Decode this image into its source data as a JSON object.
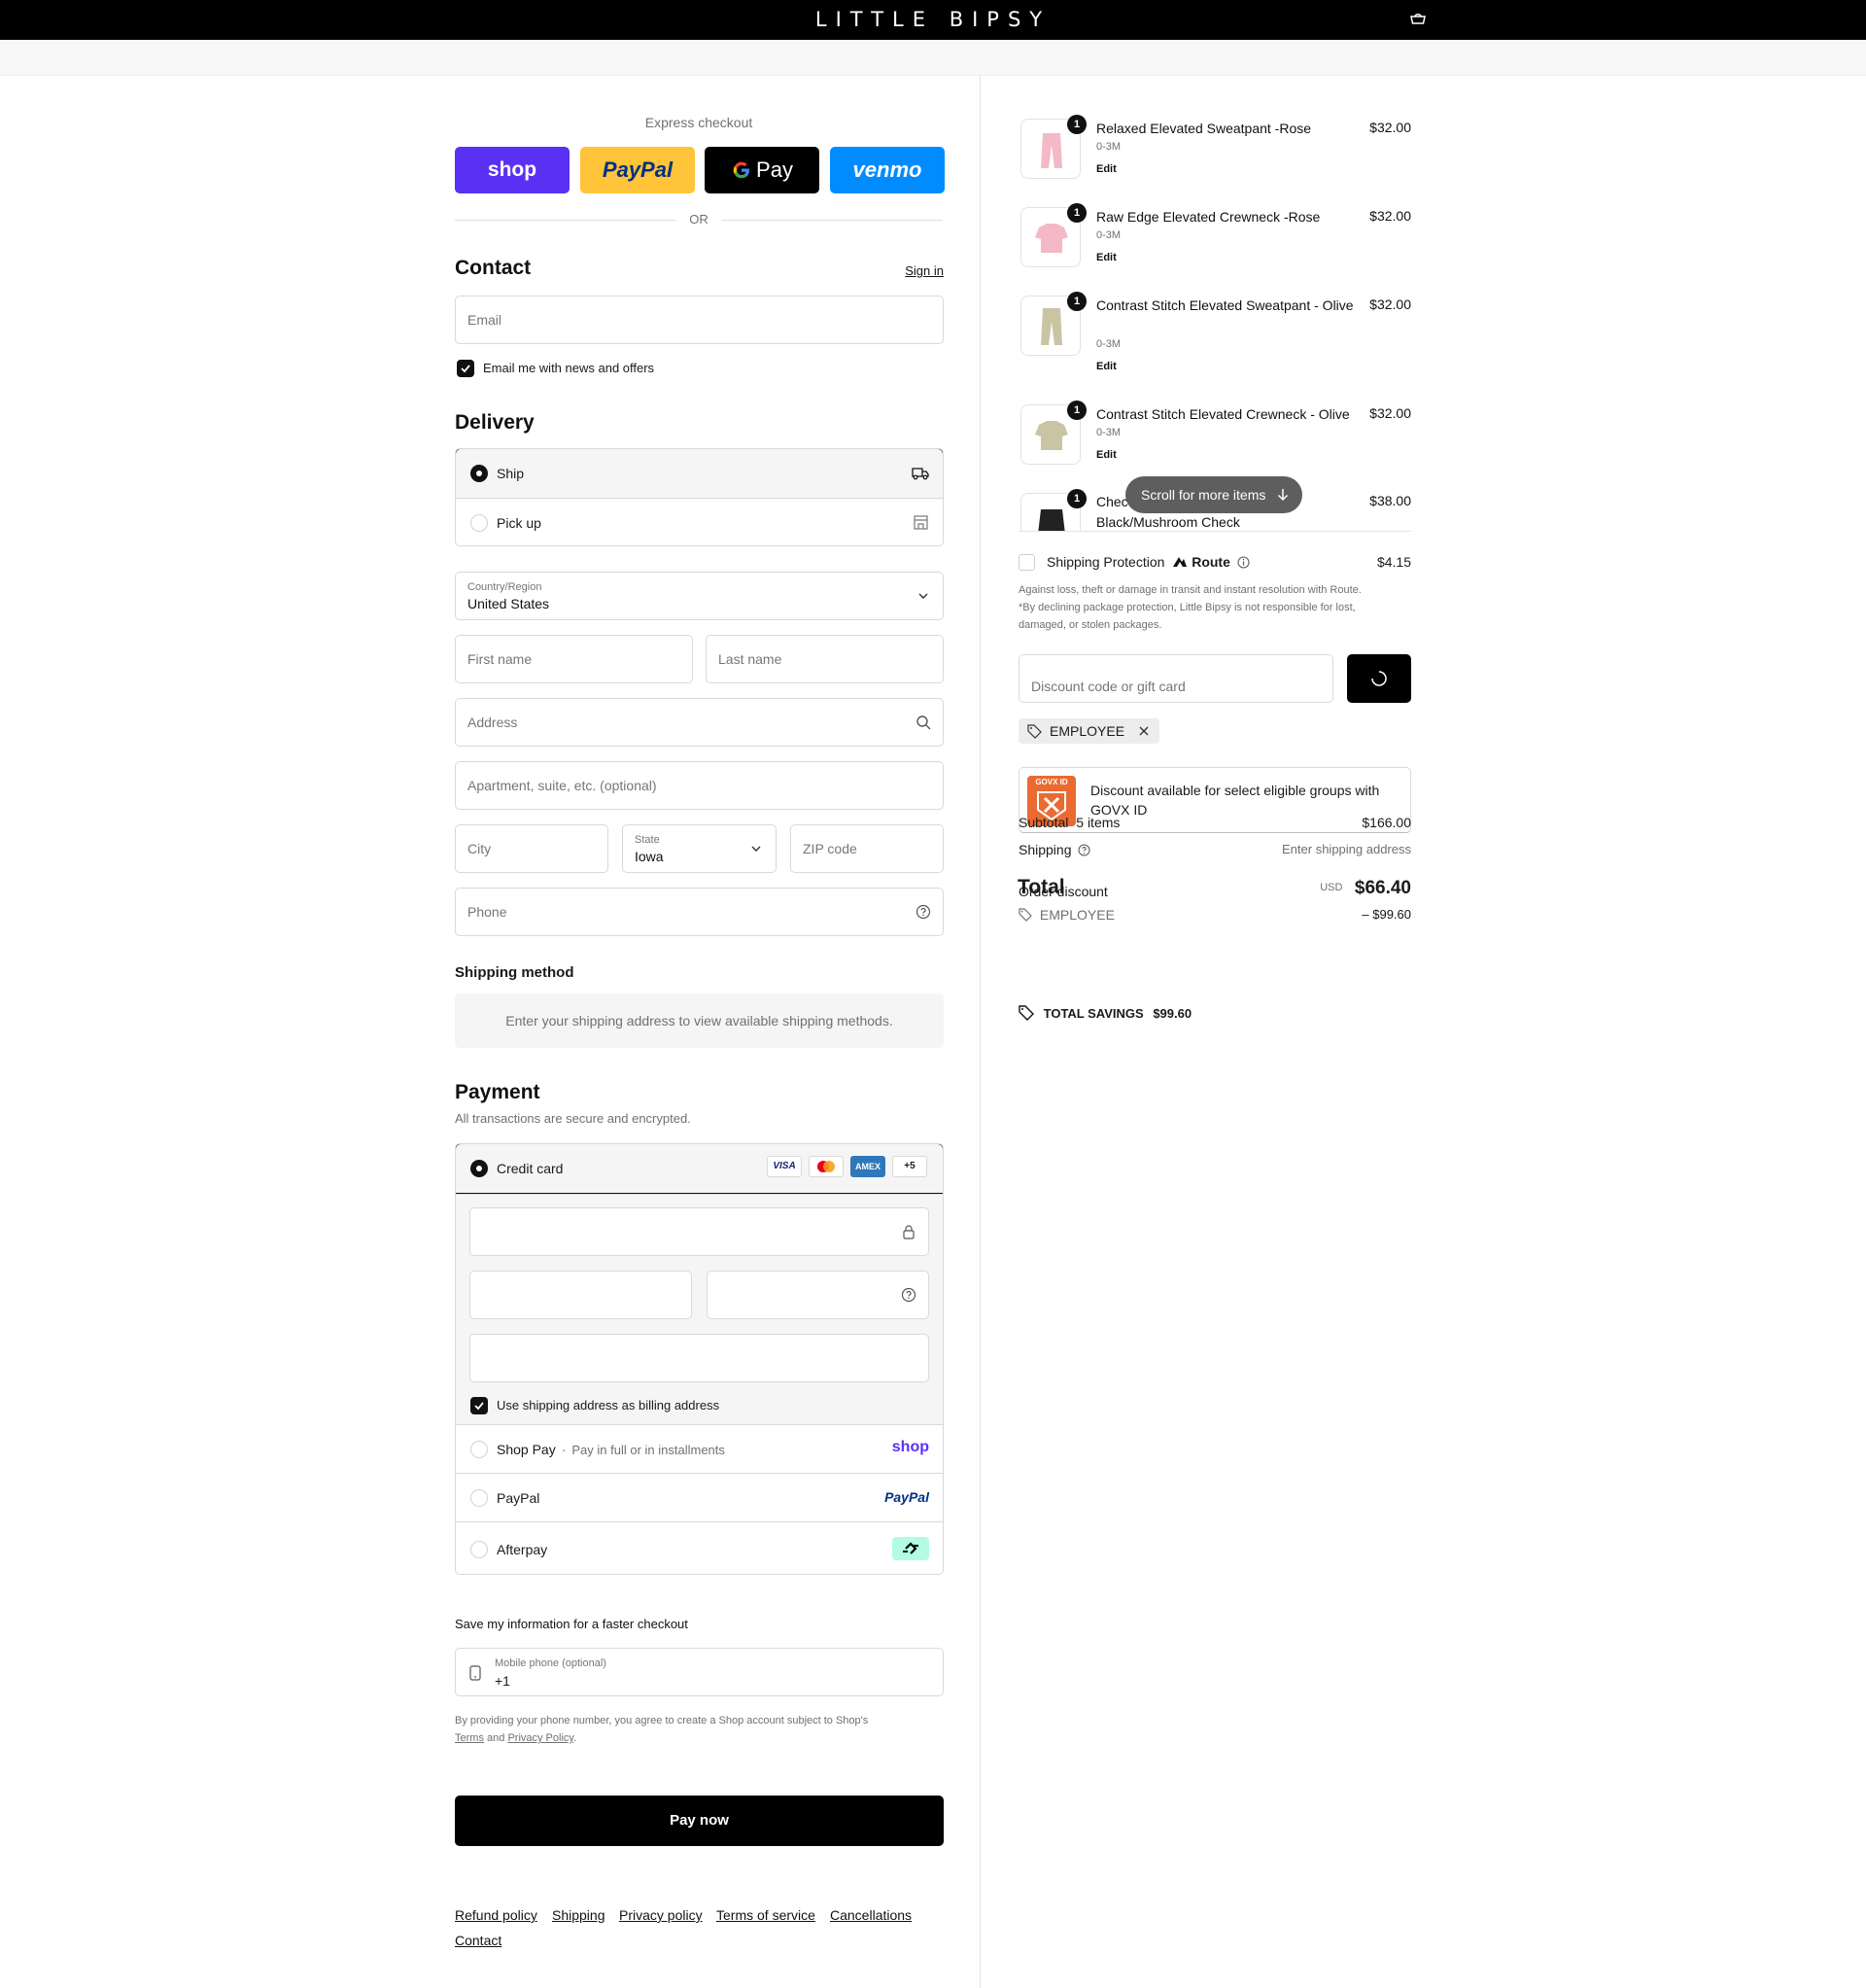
{
  "header": {
    "brand": "LITTLE BIPSY"
  },
  "express": {
    "label": "Express checkout",
    "buttons": [
      {
        "name": "shop",
        "label": "shop",
        "bg": "#5a31f4",
        "color": "#ffffff"
      },
      {
        "name": "paypal",
        "label": "PayPal",
        "bg": "#ffc439",
        "color": "#003087"
      },
      {
        "name": "gpay",
        "label": "Pay",
        "bg": "#000000",
        "color": "#ffffff"
      },
      {
        "name": "venmo",
        "label": "venmo",
        "bg": "#008cff",
        "color": "#ffffff"
      }
    ],
    "or_label": "OR"
  },
  "contact": {
    "title": "Contact",
    "sign_in": "Sign in",
    "email_placeholder": "Email",
    "newsletter_label": "Email me with news and offers",
    "newsletter_checked": true
  },
  "delivery": {
    "title": "Delivery",
    "options": [
      {
        "label": "Ship",
        "selected": true,
        "icon": "truck-icon"
      },
      {
        "label": "Pick up",
        "selected": false,
        "icon": "store-icon"
      }
    ],
    "country_label": "Country/Region",
    "country_value": "United States",
    "first_name_placeholder": "First name",
    "last_name_placeholder": "Last name",
    "address_placeholder": "Address",
    "apartment_placeholder": "Apartment, suite, etc. (optional)",
    "city_placeholder": "City",
    "state_label": "State",
    "state_value": "Iowa",
    "zip_placeholder": "ZIP code",
    "phone_placeholder": "Phone"
  },
  "shipping_method": {
    "title": "Shipping method",
    "message": "Enter your shipping address to view available shipping methods."
  },
  "payment": {
    "title": "Payment",
    "subtitle": "All transactions are secure and encrypted.",
    "credit_card_label": "Credit card",
    "card_badges": [
      "VISA",
      "",
      "AMEX",
      "+5"
    ],
    "billing_same_label": "Use shipping address as billing address",
    "billing_same_checked": true,
    "shop_pay_label": "Shop Pay",
    "shop_pay_sub": "Pay in full or in installments",
    "shop_pay_logo": "shop",
    "paypal_label": "PayPal",
    "paypal_logo": "PayPal",
    "afterpay_label": "Afterpay"
  },
  "save_info": {
    "title": "Save my information for a faster checkout",
    "mobile_label": "Mobile phone (optional)",
    "mobile_value": "+1",
    "legal_prefix": "By providing your phone number, you agree to create a Shop account subject to Shop's",
    "terms": "Terms",
    "and": "and",
    "privacy": "Privacy Policy",
    "period": "."
  },
  "pay_now": "Pay now",
  "footer_links": [
    "Refund policy",
    "Shipping",
    "Privacy policy",
    "Terms of service",
    "Cancellations",
    "Contact"
  ],
  "cart": {
    "items": [
      {
        "name": "Relaxed Elevated Sweatpant -Rose",
        "variant": "0-3M",
        "edit": "Edit",
        "price": "$32.00",
        "qty": "1",
        "color": "#f4b8c6"
      },
      {
        "name": "Raw Edge Elevated Crewneck -Rose",
        "variant": "0-3M",
        "edit": "Edit",
        "price": "$32.00",
        "qty": "1",
        "color": "#f4b8c6"
      },
      {
        "name": "Contrast Stitch Elevated Sweatpant - Olive",
        "variant": "0-3M",
        "edit": "Edit",
        "price": "$32.00",
        "qty": "1",
        "color": "#c9c4a4"
      },
      {
        "name": "Contrast Stitch Elevated Crewneck - Olive",
        "variant": "0-3M",
        "edit": "Edit",
        "price": "$32.00",
        "qty": "1",
        "color": "#c9c4a4"
      },
      {
        "name_partial": "Chec",
        "name_line2": "Black/Mushroom Check",
        "price": "$38.00",
        "qty": "1",
        "color": "#222222"
      }
    ],
    "scroll_hint": "Scroll for more items",
    "protection": {
      "label": "Shipping Protection",
      "brand": "Route",
      "price": "$4.15",
      "note": "Against loss, theft or damage in transit and instant resolution with Route.",
      "note2": "*By declining package protection, Little Bipsy is not responsible for lost,",
      "note3": "damaged, or stolen packages."
    },
    "discount_placeholder": "Discount code or gift card",
    "applied_code": "EMPLOYEE",
    "govx": {
      "text": "Discount available for select eligible groups with GOVX ID",
      "logo_text": "GOVX ID"
    },
    "subtotal_label": "Subtotal",
    "subtotal_items": "5 items",
    "subtotal_value": "$166.00",
    "shipping_label": "Shipping",
    "shipping_value": "Enter shipping address",
    "order_discount_label": "Order discount",
    "employee_code": "EMPLOYEE",
    "discount_value": "– $99.60",
    "total_label": "Total",
    "currency": "USD",
    "total_value": "$66.40",
    "savings_label": "TOTAL SAVINGS",
    "savings_value": "$99.60"
  }
}
